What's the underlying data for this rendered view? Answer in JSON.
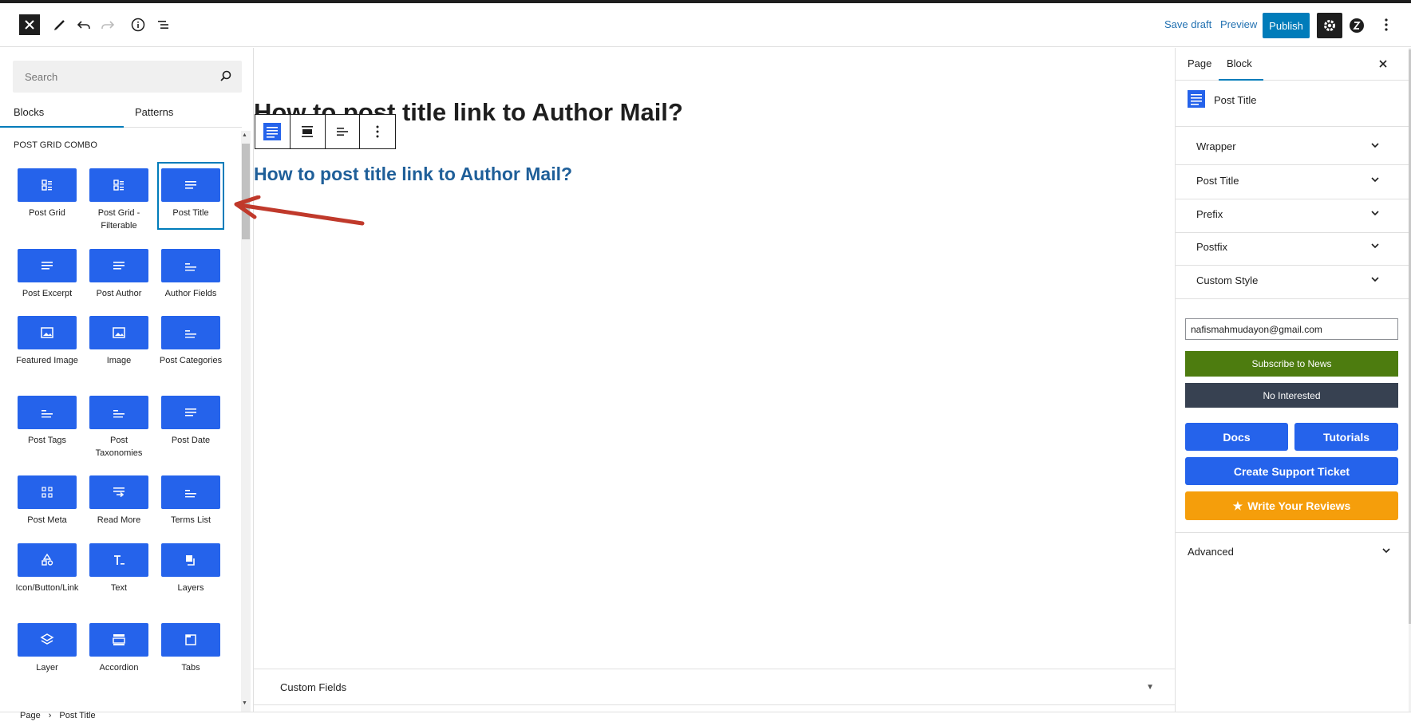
{
  "topbar": {
    "save_draft": "Save draft",
    "preview": "Preview",
    "publish": "Publish"
  },
  "inserter": {
    "search_placeholder": "Search",
    "tabs": [
      "Blocks",
      "Patterns"
    ],
    "category": "POST GRID COMBO",
    "blocks": [
      {
        "label": "Post Grid",
        "icon": "grid-icon"
      },
      {
        "label": "Post Grid - Filterable",
        "icon": "grid-icon"
      },
      {
        "label": "Post Title",
        "icon": "title-lines-icon",
        "selected": true
      },
      {
        "label": "Post Excerpt",
        "icon": "excerpt-lines-icon"
      },
      {
        "label": "Post Author",
        "icon": "author-lines-icon"
      },
      {
        "label": "Author Fields",
        "icon": "author-fields-icon"
      },
      {
        "label": "Featured Image",
        "icon": "image-icon"
      },
      {
        "label": "Image",
        "icon": "image-icon"
      },
      {
        "label": "Post Categories",
        "icon": "categories-icon"
      },
      {
        "label": "Post Tags",
        "icon": "tags-icon"
      },
      {
        "label": "Post Taxonomies",
        "icon": "taxonomies-icon"
      },
      {
        "label": "Post Date",
        "icon": "date-lines-icon"
      },
      {
        "label": "Post Meta",
        "icon": "meta-grid-icon"
      },
      {
        "label": "Read More",
        "icon": "read-more-icon"
      },
      {
        "label": "Terms List",
        "icon": "terms-list-icon"
      },
      {
        "label": "Icon/Button/Link",
        "icon": "shapes-icon"
      },
      {
        "label": "Text",
        "icon": "text-icon"
      },
      {
        "label": "Layers",
        "icon": "layers-stack-icon"
      },
      {
        "label": "Layer",
        "icon": "layer-icon"
      },
      {
        "label": "Accordion",
        "icon": "accordion-icon"
      },
      {
        "label": "Tabs",
        "icon": "tabs-icon"
      }
    ]
  },
  "canvas": {
    "heading": "How to post title link to Author Mail?",
    "post_title_link": "How to post title link to Author Mail?",
    "custom_fields": "Custom Fields"
  },
  "sidebar": {
    "tabs": [
      "Page",
      "Block"
    ],
    "block_name": "Post Title",
    "panels": [
      "Wrapper",
      "Post Title",
      "Prefix",
      "Postfix",
      "Custom Style"
    ],
    "email_value": "nafismahmudayon@gmail.com",
    "subscribe": "Subscribe to News",
    "no_interested": "No Interested",
    "docs": "Docs",
    "tutorials": "Tutorials",
    "support": "Create Support Ticket",
    "reviews": "Write Your Reviews",
    "advanced": "Advanced"
  },
  "footer": {
    "crumb_root": "Page",
    "crumb_current": "Post Title"
  },
  "colors": {
    "accent": "#007cba",
    "block_icon_bg": "#2563eb",
    "subscribe_bg": "#4d7c0f",
    "no_interest_bg": "#374151",
    "review_bg": "#f59e0b",
    "link_color": "#1f5f99",
    "arrow": "#c0392b"
  }
}
